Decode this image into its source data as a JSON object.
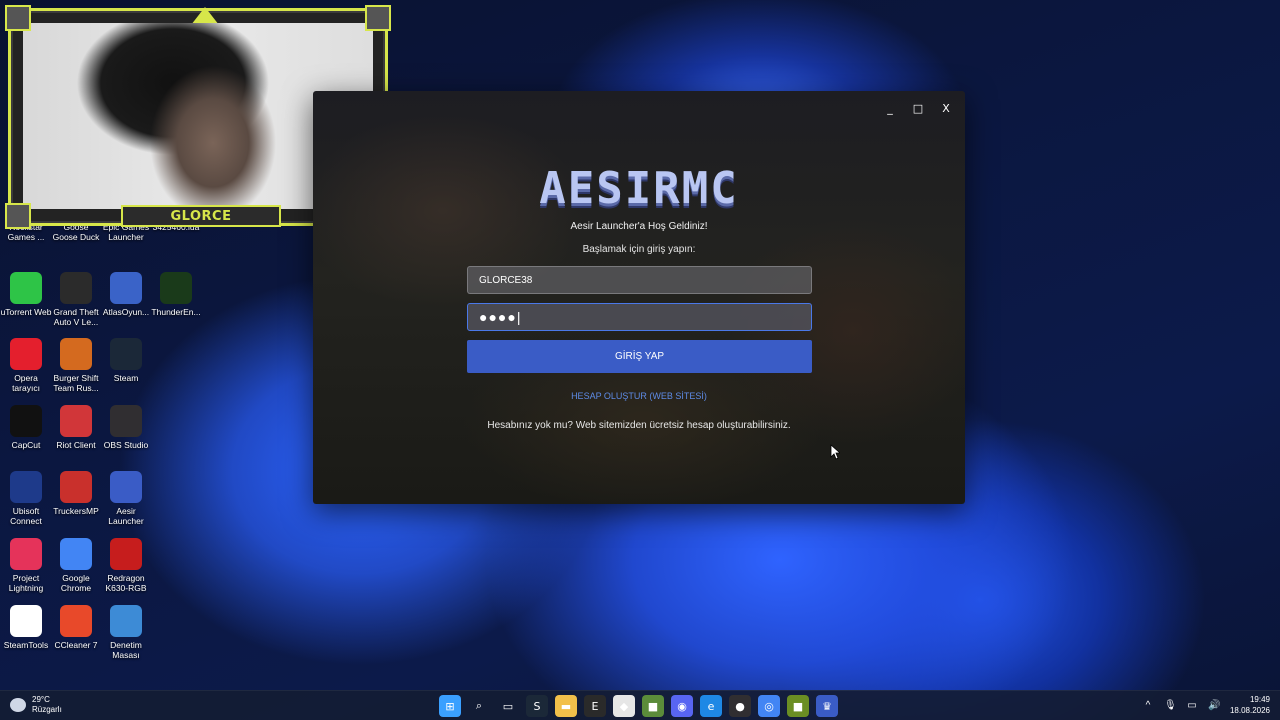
{
  "webcam": {
    "name": "GLORCE"
  },
  "desktop_icons": [
    {
      "label": "Rockstar Games ...",
      "icon": "rockstar-icon",
      "color": "#f7a21b"
    },
    {
      "label": "Goose Goose Duck",
      "icon": "goose-goose-duck-icon",
      "color": "#ffffff"
    },
    {
      "label": "Epic Games Launcher",
      "icon": "epic-games-icon",
      "color": "#2a2a2a"
    },
    {
      "label": "3425460.lua",
      "icon": "file-icon",
      "color": "#ffffff"
    },
    {
      "label": "uTorrent Web",
      "icon": "utorrent-icon",
      "color": "#2ec447"
    },
    {
      "label": "Grand Theft Auto V Le...",
      "icon": "gta-icon",
      "color": "#2b2b2b"
    },
    {
      "label": "AtlasOyun...",
      "icon": "atlas-oyun-icon",
      "color": "#3a63c8"
    },
    {
      "label": "ThunderEn...",
      "icon": "thunder-engine-icon",
      "color": "#1a3a1a"
    },
    {
      "label": "Opera tarayıcı",
      "icon": "opera-icon",
      "color": "#e41f2d"
    },
    {
      "label": "Burger Shift Team Rus...",
      "icon": "burger-shift-icon",
      "color": "#d46a1f"
    },
    {
      "label": "Steam",
      "icon": "steam-icon",
      "color": "#1b2838"
    },
    {
      "label": "CapCut",
      "icon": "capcut-icon",
      "color": "#111111"
    },
    {
      "label": "Riot Client",
      "icon": "riot-client-icon",
      "color": "#d13639"
    },
    {
      "label": "OBS Studio",
      "icon": "obs-icon",
      "color": "#302e31"
    },
    {
      "label": "Ubisoft Connect",
      "icon": "ubisoft-icon",
      "color": "#1e3a8a"
    },
    {
      "label": "TruckersMP",
      "icon": "truckersmp-icon",
      "color": "#c9302c"
    },
    {
      "label": "Aesir Launcher",
      "icon": "aesir-launcher-icon",
      "color": "#3a5cc6"
    },
    {
      "label": "Project Lightning",
      "icon": "project-lightning-icon",
      "color": "#e5335a"
    },
    {
      "label": "Google Chrome",
      "icon": "chrome-icon",
      "color": "#4285f4"
    },
    {
      "label": "Redragon K630-RGB",
      "icon": "redragon-icon",
      "color": "#c61d1d"
    },
    {
      "label": "SteamTools",
      "icon": "steamtools-icon",
      "color": "#ffffff"
    },
    {
      "label": "CCleaner 7",
      "icon": "ccleaner-icon",
      "color": "#e8492a"
    },
    {
      "label": "Denetim Masası",
      "icon": "control-panel-icon",
      "color": "#3d8bd6"
    }
  ],
  "launcher": {
    "controls": {
      "minimize": "_",
      "maximize": "□",
      "close": "X"
    },
    "logo": "AESIRMC",
    "welcome": "Aesir Launcher'a Hoş Geldiniz!",
    "subtitle": "Başlamak için giriş yapın:",
    "username_value": "GLORCE38",
    "password_value": "●●●●|",
    "login_button": "GİRİŞ YAP",
    "register_link": "HESAP OLUŞTUR (WEB SİTESİ)",
    "no_account_text": "Hesabınız yok mu? Web sitemizden ücretsiz hesap oluşturabilirsiniz.",
    "accent_color": "#3a5cc6"
  },
  "taskbar": {
    "weather_temp": "29°C",
    "weather_desc": "Rüzgarlı",
    "apps": [
      {
        "icon": "windows-start-icon",
        "glyph": "⊞",
        "color": "#3aa0ff"
      },
      {
        "icon": "search-icon",
        "glyph": "⌕",
        "color": "transparent"
      },
      {
        "icon": "task-view-icon",
        "glyph": "▭",
        "color": "transparent"
      },
      {
        "icon": "steam-icon",
        "glyph": "S",
        "color": "#1b2838"
      },
      {
        "icon": "file-explorer-icon",
        "glyph": "▬",
        "color": "#f2c04a"
      },
      {
        "icon": "epic-games-icon",
        "glyph": "E",
        "color": "#2a2a2a"
      },
      {
        "icon": "roblox-icon",
        "glyph": "◆",
        "color": "#e6e6e6"
      },
      {
        "icon": "minecraft-icon",
        "glyph": "■",
        "color": "#5b8c3a"
      },
      {
        "icon": "discord-icon",
        "glyph": "◉",
        "color": "#5865f2"
      },
      {
        "icon": "edge-icon",
        "glyph": "e",
        "color": "#1e88e5"
      },
      {
        "icon": "obs-icon",
        "glyph": "●",
        "color": "#302e31"
      },
      {
        "icon": "chrome-icon",
        "glyph": "◎",
        "color": "#4285f4"
      },
      {
        "icon": "minecraft-launcher-icon",
        "glyph": "■",
        "color": "#6b8e23"
      },
      {
        "icon": "aesir-launcher-icon",
        "glyph": "♛",
        "color": "#3a5cc6"
      }
    ],
    "tray": {
      "chevron": "^",
      "mic": "🎙",
      "network": "▭",
      "volume": "🔊",
      "time": "19:49",
      "date": "18.08.2026"
    }
  }
}
